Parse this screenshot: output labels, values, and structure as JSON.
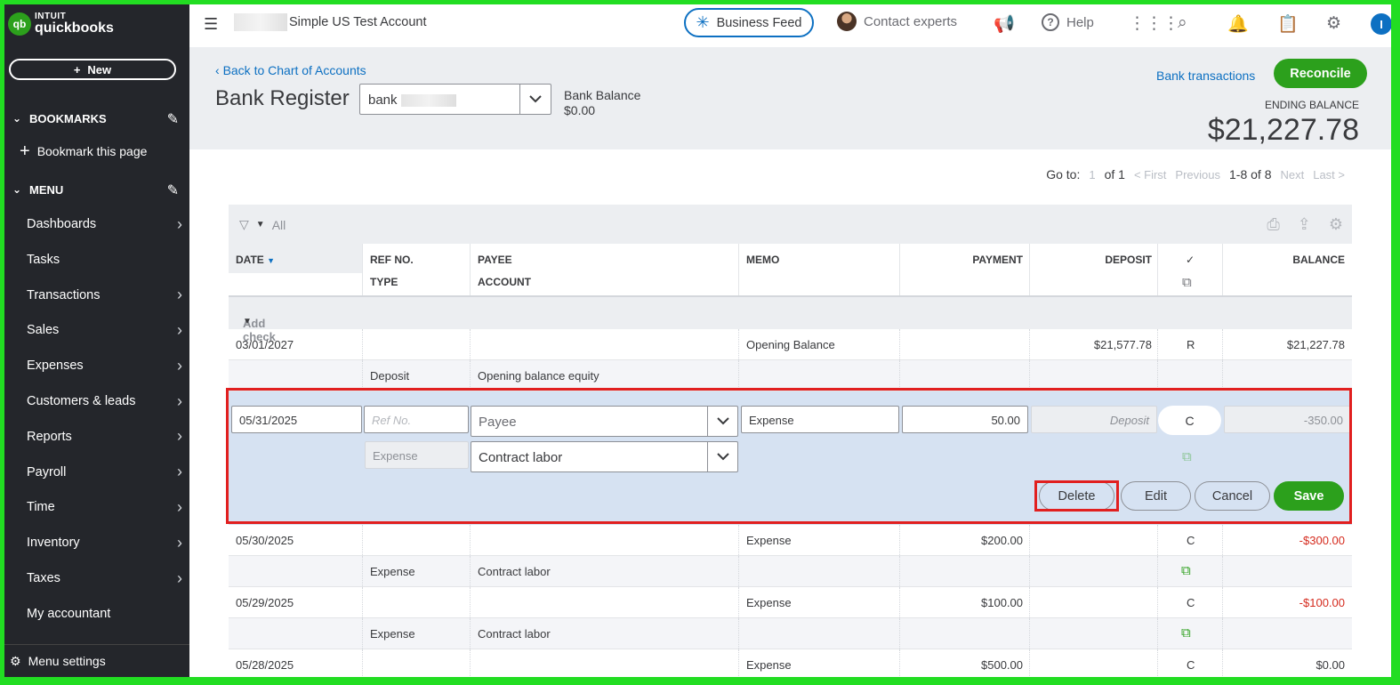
{
  "sidebar": {
    "logo_line1": "INTUIT",
    "logo_line2": "quickbooks",
    "logo_mark": "qb",
    "new_label": "New",
    "bookmarks_label": "BOOKMARKS",
    "bookmark_item": "Bookmark this page",
    "menu_label": "MENU",
    "items": [
      {
        "label": "Dashboards",
        "arrow": true
      },
      {
        "label": "Tasks",
        "arrow": false
      },
      {
        "label": "Transactions",
        "arrow": true
      },
      {
        "label": "Sales",
        "arrow": true
      },
      {
        "label": "Expenses",
        "arrow": true
      },
      {
        "label": "Customers & leads",
        "arrow": true
      },
      {
        "label": "Reports",
        "arrow": true
      },
      {
        "label": "Payroll",
        "arrow": true
      },
      {
        "label": "Time",
        "arrow": true
      },
      {
        "label": "Inventory",
        "arrow": true
      },
      {
        "label": "Taxes",
        "arrow": true
      },
      {
        "label": "My accountant",
        "arrow": false
      }
    ],
    "settings_label": "Menu settings"
  },
  "topbar": {
    "account_name": "Simple US Test Account",
    "business_feed": "Business Feed",
    "contact_experts": "Contact experts",
    "help": "Help",
    "user_initial": "I"
  },
  "header": {
    "back_link": "Back to Chart of Accounts",
    "title": "Bank Register",
    "account_value": "bank",
    "bank_balance_label": "Bank Balance",
    "bank_balance_value": "$0.00",
    "bank_transactions": "Bank transactions",
    "reconcile": "Reconcile",
    "ending_balance_label": "ENDING BALANCE",
    "ending_balance_value": "$21,227.78"
  },
  "pager": {
    "goto": "Go to:",
    "page": "1",
    "of": "of 1",
    "first": "< First",
    "previous": "Previous",
    "range": "1-8 of 8",
    "next": "Next",
    "last": "Last >"
  },
  "table": {
    "filter_label": "All",
    "columns": {
      "date": "DATE",
      "ref_no": "REF NO.",
      "type": "TYPE",
      "payee": "PAYEE",
      "account": "ACCOUNT",
      "memo": "MEMO",
      "payment": "PAYMENT",
      "deposit": "DEPOSIT",
      "cleared": "✓",
      "balance": "BALANCE"
    },
    "add_check": "Add check",
    "rows_before": [
      {
        "date": "03/01/2027",
        "type": "Deposit",
        "account": "Opening balance equity",
        "memo": "Opening Balance",
        "payment": "",
        "deposit": "$21,577.78",
        "status": "R",
        "balance": "$21,227.78",
        "negative": false
      }
    ],
    "edit": {
      "date": "05/31/2025",
      "ref_placeholder": "Ref No.",
      "payee_placeholder": "Payee",
      "memo": "Expense",
      "payment": "50.00",
      "deposit_placeholder": "Deposit",
      "status": "C",
      "balance": "-350.00",
      "type": "Expense",
      "account": "Contract labor",
      "delete": "Delete",
      "edit": "Edit",
      "cancel": "Cancel",
      "save": "Save"
    },
    "rows_after": [
      {
        "date": "05/30/2025",
        "type": "Expense",
        "account": "Contract labor",
        "memo": "Expense",
        "payment": "$200.00",
        "deposit": "",
        "status": "C",
        "balance": "-$300.00",
        "negative": true
      },
      {
        "date": "05/29/2025",
        "type": "Expense",
        "account": "Contract labor",
        "memo": "Expense",
        "payment": "$100.00",
        "deposit": "",
        "status": "C",
        "balance": "-$100.00",
        "negative": true
      },
      {
        "date": "05/28/2025",
        "type": "",
        "account": "",
        "memo": "Expense",
        "payment": "$500.00",
        "deposit": "",
        "status": "C",
        "balance": "$0.00",
        "negative": false
      }
    ]
  },
  "colors": {
    "brand_green": "#2ca01c",
    "link_blue": "#0d70c2",
    "sidebar_bg": "#24262b",
    "highlight_red": "#e11f1f",
    "negative_red": "#d52b1e"
  }
}
